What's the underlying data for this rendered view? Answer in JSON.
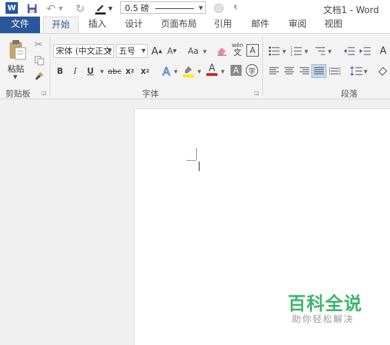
{
  "titlebar": {
    "logo": "W",
    "line_weight": "0.5 磅",
    "doc_title": "文档1 - Word"
  },
  "tabs": {
    "file": "文件",
    "items": [
      "开始",
      "插入",
      "设计",
      "页面布局",
      "引用",
      "邮件",
      "审阅",
      "视图"
    ]
  },
  "ribbon": {
    "clipboard": {
      "paste": "粘贴",
      "label": "剪贴板"
    },
    "font": {
      "font_name": "宋体 (中文正文",
      "font_size": "五号",
      "grow": "A",
      "shrink": "A",
      "change_case": "Aa",
      "phonetic_top": "wén",
      "phonetic_bottom": "文",
      "char_border": "A",
      "bold": "B",
      "italic": "I",
      "underline": "U",
      "strike": "abc",
      "subscript": "x",
      "subscript_mark": "2",
      "superscript": "x",
      "superscript_mark": "2",
      "text_effect": "A",
      "font_color": "A",
      "char_shade": "A",
      "enclose": "字",
      "label": "字体"
    },
    "paragraph": {
      "label": "段落"
    }
  },
  "watermark": {
    "title": "百科全说",
    "subtitle": "助你轻松解决"
  },
  "colors": {
    "brand": "#2b579a",
    "font_color_bar": "#d22323",
    "highlight_bar": "#ffea00",
    "watermark": "#3cb56b"
  }
}
